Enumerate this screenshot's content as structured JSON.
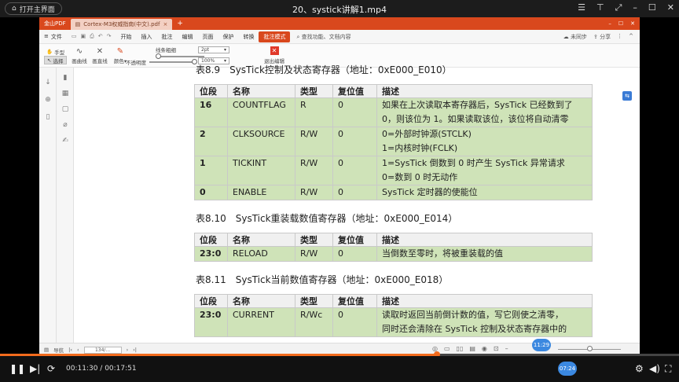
{
  "player": {
    "home_label": "打开主界面",
    "title": "20、systick讲解1.mp4",
    "current_time": "00:11:30",
    "total_time": "00:17:51",
    "progress_fraction": 0.644,
    "hover_time": "11:29",
    "marker_time": "07:24",
    "accent": "#f26b1d",
    "marker_color": "#3b88e0"
  },
  "wps": {
    "app_label": "金山PDF",
    "doc_tab": "Cortex-M3权威指南(中文).pdf",
    "menu": {
      "file": "文件",
      "items": [
        "开始",
        "插入",
        "批注",
        "编辑",
        "页面",
        "保护",
        "转换",
        "批注模式"
      ],
      "active": "批注模式",
      "search": "查找功能、文档内容",
      "sync": "未同步",
      "share": "分享"
    },
    "toolbar": {
      "hand": "手型",
      "select": "选择",
      "curve": "画曲线",
      "line": "画直线",
      "color": "颜色",
      "opacity": "不透明度",
      "thickness": "线条粗细",
      "size_value": "2pt",
      "opacity_value": "100%",
      "exit": "退出编辑"
    },
    "status": {
      "nav_label": "导航",
      "page": "134",
      "page_box": "134/..."
    },
    "brand_color": "#d9481d"
  },
  "doc": {
    "tables": [
      {
        "caption": "表8.9　SysTick控制及状态寄存器（地址：0xE000_E010）",
        "headers": [
          "位段",
          "名称",
          "类型",
          "复位值",
          "描述"
        ],
        "rows": [
          [
            "16",
            "COUNTFLAG",
            "R",
            "0",
            [
              "如果在上次读取本寄存器后，SysTick 已经数到了",
              "0，则该位为 1。如果读取该位，该位将自动清零"
            ]
          ],
          [
            "2",
            "CLKSOURCE",
            "R/W",
            "0",
            [
              "0=外部时钟源(STCLK)",
              "1=内核时钟(FCLK)"
            ]
          ],
          [
            "1",
            "TICKINT",
            "R/W",
            "0",
            [
              "1=SysTick 倒数到 0 时产生 SysTick 异常请求",
              "0=数到 0 时无动作"
            ]
          ],
          [
            "0",
            "ENABLE",
            "R/W",
            "0",
            [
              "SysTick 定时器的使能位"
            ]
          ]
        ]
      },
      {
        "caption": "表8.10　SysTick重装载数值寄存器（地址：0xE000_E014）",
        "headers": [
          "位段",
          "名称",
          "类型",
          "复位值",
          "描述"
        ],
        "rows": [
          [
            "23:0",
            "RELOAD",
            "R/W",
            "0",
            [
              "当倒数至零时，将被重装载的值"
            ]
          ]
        ]
      },
      {
        "caption": "表8.11　SysTick当前数值寄存器（地址：0xE000_E018）",
        "headers": [
          "位段",
          "名称",
          "类型",
          "复位值",
          "描述"
        ],
        "rows": [
          [
            "23:0",
            "CURRENT",
            "R/Wc",
            "0",
            [
              "读取时返回当前倒计数的值，写它则使之清零，",
              "同时还会清除在 SysTick 控制及状态寄存器中的"
            ]
          ]
        ]
      }
    ]
  }
}
